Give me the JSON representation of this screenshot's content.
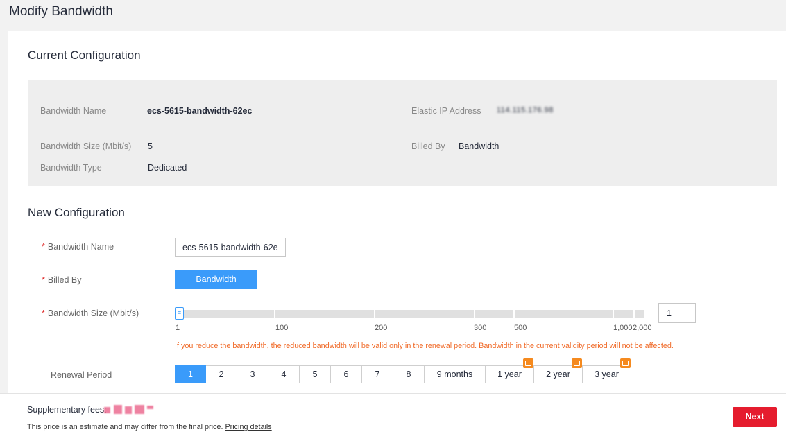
{
  "page": {
    "title": "Modify Bandwidth"
  },
  "current": {
    "title": "Current Configuration",
    "bandwidth_name_label": "Bandwidth Name",
    "bandwidth_name": "ecs-5615-bandwidth-62ec",
    "eip_label": "Elastic IP Address",
    "eip": "114.115.176.98",
    "size_label": "Bandwidth Size (Mbit/s)",
    "size": "5",
    "billed_by_label": "Billed By",
    "billed_by": "Bandwidth",
    "type_label": "Bandwidth Type",
    "type": "Dedicated"
  },
  "new_config": {
    "title": "New Configuration",
    "name_label": "Bandwidth Name",
    "name_value": "ecs-5615-bandwidth-62e",
    "billed_label": "Billed By",
    "billed_option": "Bandwidth",
    "size_label": "Bandwidth Size (Mbit/s)",
    "size_value": "1",
    "slider_fraction": 0.0,
    "handle_glyph": "≡",
    "ticks": [
      "1",
      "100",
      "200",
      "300",
      "500",
      "1,000",
      "2,000"
    ],
    "warning": "If you reduce the bandwidth, the reduced bandwidth will be valid only in the renewal period. Bandwidth in the current validity period will not be affected.",
    "renewal_label": "Renewal Period",
    "periods": [
      "1",
      "2",
      "3",
      "4",
      "5",
      "6",
      "7",
      "8",
      "9 months",
      "1 year",
      "2 year",
      "3 year"
    ],
    "selected_period": "1"
  },
  "footer": {
    "fee_label": "Supplementary fees:",
    "note": "This price is an estimate and may differ from the final price.",
    "pricing_link": "Pricing details",
    "next_label": "Next"
  },
  "colors": {
    "accent": "#3a9bfa",
    "primary_action": "#e51c2e",
    "warning": "#f06a28",
    "discount_badge": "#f58a1f"
  },
  "icons": {
    "required_marker": "*",
    "discount": "discount-badge-icon"
  }
}
